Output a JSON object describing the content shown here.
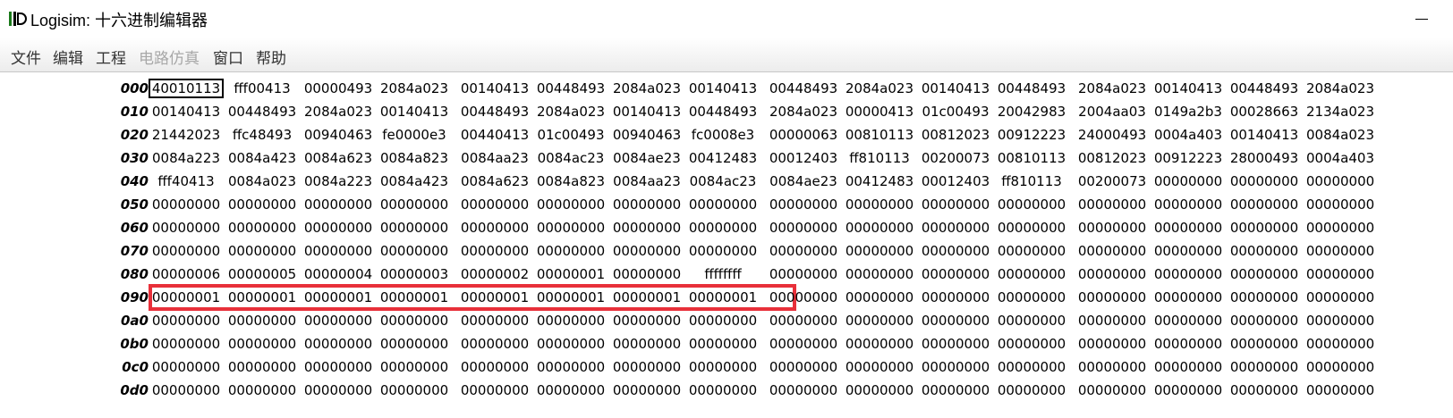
{
  "window": {
    "title": "Logisim: 十六进制编辑器",
    "icon": "logisim-app-icon",
    "minimize_icon": "minimize-icon"
  },
  "menubar": {
    "items": [
      {
        "label": "文件",
        "enabled": true
      },
      {
        "label": "编辑",
        "enabled": true
      },
      {
        "label": "工程",
        "enabled": true
      },
      {
        "label": "电路仿真",
        "enabled": false
      },
      {
        "label": "窗口",
        "enabled": true
      },
      {
        "label": "帮助",
        "enabled": true
      }
    ]
  },
  "editor": {
    "selected_cell": {
      "row": 0,
      "col": 0
    },
    "highlight": {
      "row": 9,
      "col_start": 0,
      "col_end": 7,
      "color": "#e8303a"
    },
    "rows": [
      {
        "addr": "000",
        "cells": [
          "40010113",
          "fff00413",
          "00000493",
          "2084a023",
          "00140413",
          "00448493",
          "2084a023",
          "00140413",
          "00448493",
          "2084a023",
          "00140413",
          "00448493",
          "2084a023",
          "00140413",
          "00448493",
          "2084a023"
        ]
      },
      {
        "addr": "010",
        "cells": [
          "00140413",
          "00448493",
          "2084a023",
          "00140413",
          "00448493",
          "2084a023",
          "00140413",
          "00448493",
          "2084a023",
          "00000413",
          "01c00493",
          "20042983",
          "2004aa03",
          "0149a2b3",
          "00028663",
          "2134a023"
        ]
      },
      {
        "addr": "020",
        "cells": [
          "21442023",
          "ffc48493",
          "00940463",
          "fe0000e3",
          "00440413",
          "01c00493",
          "00940463",
          "fc0008e3",
          "00000063",
          "00810113",
          "00812023",
          "00912223",
          "24000493",
          "0004a403",
          "00140413",
          "0084a023"
        ]
      },
      {
        "addr": "030",
        "cells": [
          "0084a223",
          "0084a423",
          "0084a623",
          "0084a823",
          "0084aa23",
          "0084ac23",
          "0084ae23",
          "00412483",
          "00012403",
          "ff810113",
          "00200073",
          "00810113",
          "00812023",
          "00912223",
          "28000493",
          "0004a403"
        ]
      },
      {
        "addr": "040",
        "cells": [
          "fff40413",
          "0084a023",
          "0084a223",
          "0084a423",
          "0084a623",
          "0084a823",
          "0084aa23",
          "0084ac23",
          "0084ae23",
          "00412483",
          "00012403",
          "ff810113",
          "00200073",
          "00000000",
          "00000000",
          "00000000"
        ]
      },
      {
        "addr": "050",
        "cells": [
          "00000000",
          "00000000",
          "00000000",
          "00000000",
          "00000000",
          "00000000",
          "00000000",
          "00000000",
          "00000000",
          "00000000",
          "00000000",
          "00000000",
          "00000000",
          "00000000",
          "00000000",
          "00000000"
        ]
      },
      {
        "addr": "060",
        "cells": [
          "00000000",
          "00000000",
          "00000000",
          "00000000",
          "00000000",
          "00000000",
          "00000000",
          "00000000",
          "00000000",
          "00000000",
          "00000000",
          "00000000",
          "00000000",
          "00000000",
          "00000000",
          "00000000"
        ]
      },
      {
        "addr": "070",
        "cells": [
          "00000000",
          "00000000",
          "00000000",
          "00000000",
          "00000000",
          "00000000",
          "00000000",
          "00000000",
          "00000000",
          "00000000",
          "00000000",
          "00000000",
          "00000000",
          "00000000",
          "00000000",
          "00000000"
        ]
      },
      {
        "addr": "080",
        "cells": [
          "00000006",
          "00000005",
          "00000004",
          "00000003",
          "00000002",
          "00000001",
          "00000000",
          "ffffffff",
          "00000000",
          "00000000",
          "00000000",
          "00000000",
          "00000000",
          "00000000",
          "00000000",
          "00000000"
        ]
      },
      {
        "addr": "090",
        "cells": [
          "00000001",
          "00000001",
          "00000001",
          "00000001",
          "00000001",
          "00000001",
          "00000001",
          "00000001",
          "00000000",
          "00000000",
          "00000000",
          "00000000",
          "00000000",
          "00000000",
          "00000000",
          "00000000"
        ]
      },
      {
        "addr": "0a0",
        "cells": [
          "00000000",
          "00000000",
          "00000000",
          "00000000",
          "00000000",
          "00000000",
          "00000000",
          "00000000",
          "00000000",
          "00000000",
          "00000000",
          "00000000",
          "00000000",
          "00000000",
          "00000000",
          "00000000"
        ]
      },
      {
        "addr": "0b0",
        "cells": [
          "00000000",
          "00000000",
          "00000000",
          "00000000",
          "00000000",
          "00000000",
          "00000000",
          "00000000",
          "00000000",
          "00000000",
          "00000000",
          "00000000",
          "00000000",
          "00000000",
          "00000000",
          "00000000"
        ]
      },
      {
        "addr": "0c0",
        "cells": [
          "00000000",
          "00000000",
          "00000000",
          "00000000",
          "00000000",
          "00000000",
          "00000000",
          "00000000",
          "00000000",
          "00000000",
          "00000000",
          "00000000",
          "00000000",
          "00000000",
          "00000000",
          "00000000"
        ]
      },
      {
        "addr": "0d0",
        "cells": [
          "00000000",
          "00000000",
          "00000000",
          "00000000",
          "00000000",
          "00000000",
          "00000000",
          "00000000",
          "00000000",
          "00000000",
          "00000000",
          "00000000",
          "00000000",
          "00000000",
          "00000000",
          "00000000"
        ]
      }
    ]
  }
}
